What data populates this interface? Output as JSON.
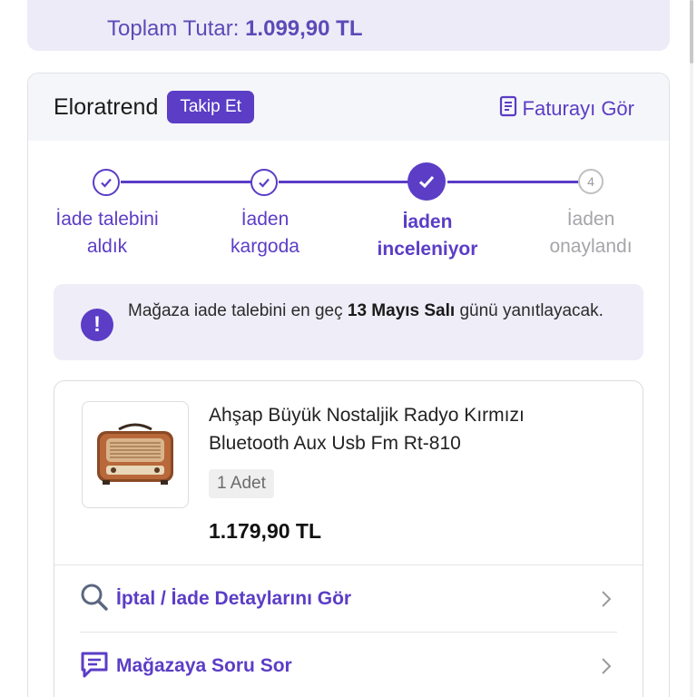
{
  "summary": {
    "previous_line": "Toplam Tutar",
    "total_label": "Toplam Tutar:",
    "total_value": "1.099,90 TL"
  },
  "store": {
    "name": "Eloratrend",
    "follow_label": "Takip Et",
    "invoice_label": "Faturayı Gör"
  },
  "progress": {
    "steps": [
      {
        "line1": "İade talebini",
        "line2": "aldık",
        "state": "done"
      },
      {
        "line1": "İaden",
        "line2": "kargoda",
        "state": "done"
      },
      {
        "line1": "İaden",
        "line2": "inceleniyor",
        "state": "active"
      },
      {
        "line1": "İaden",
        "line2": "onaylandı",
        "state": "pending",
        "number": "4"
      }
    ]
  },
  "info": {
    "text_before": "Mağaza iade talebini en geç ",
    "date": "13 Mayıs Salı",
    "text_after": " günü yanıtlayacak."
  },
  "product": {
    "title": "Ahşap Büyük Nostaljik Radyo Kırmızı Bluetooth Aux Usb Fm Rt-810",
    "quantity": "1 Adet",
    "price": "1.179,90 TL"
  },
  "actions": {
    "details_label": "İptal / İade Detaylarını Gör",
    "ask_label": "Mağazaya Soru Sor"
  },
  "colors": {
    "accent": "#5b3dc6",
    "info_bg": "#efedf7",
    "header_bg": "#f5f6f9"
  }
}
